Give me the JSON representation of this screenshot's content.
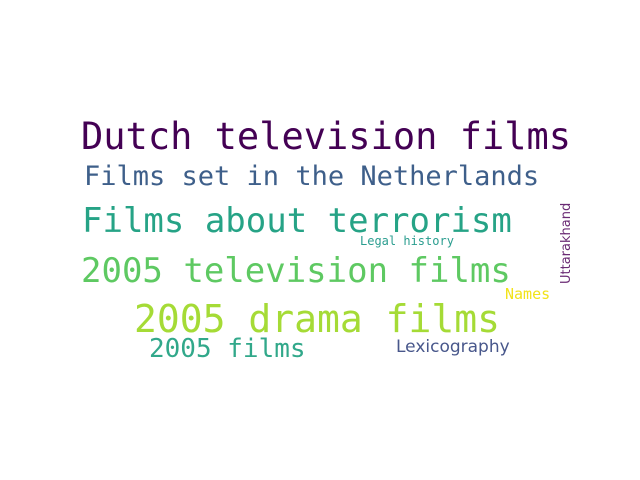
{
  "words": [
    {
      "text": "Dutch television films",
      "color": "#440154"
    },
    {
      "text": "Films set in the Netherlands",
      "color": "#3e5f8a"
    },
    {
      "text": "Films about terrorism",
      "color": "#26a386"
    },
    {
      "text": "2005 television films",
      "color": "#5ec962"
    },
    {
      "text": "2005 drama films",
      "color": "#a5db36"
    },
    {
      "text": "2005 films",
      "color": "#31a88a"
    },
    {
      "text": "Lexicography",
      "color": "#48578b"
    },
    {
      "text": "Legal history",
      "color": "#2a9d8f"
    },
    {
      "text": "Names",
      "color": "#f2e31a"
    },
    {
      "text": "Uttarakhand",
      "color": "#6a2a74"
    }
  ]
}
